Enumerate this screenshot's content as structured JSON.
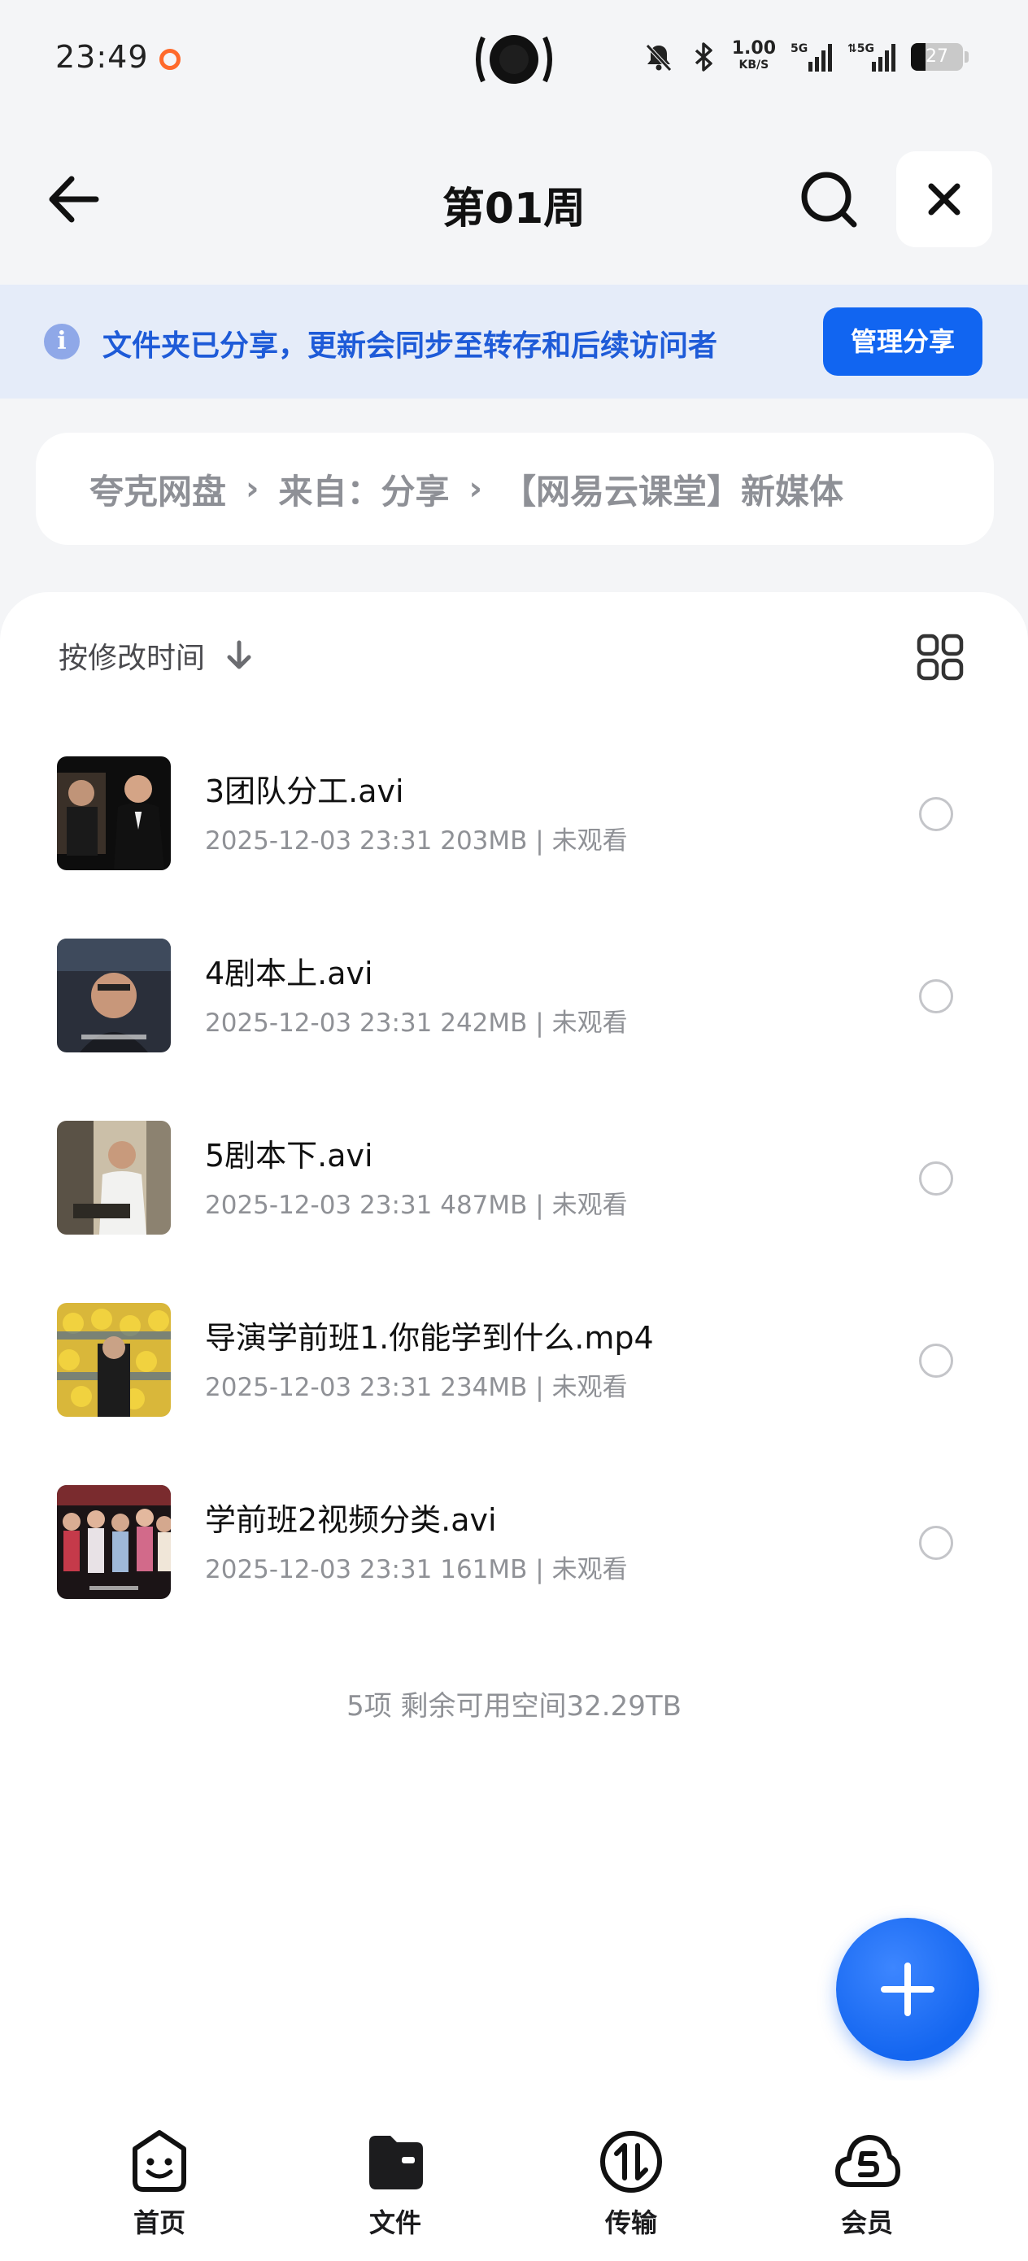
{
  "status_bar": {
    "time": "23:49",
    "net_speed": "1.00",
    "net_unit": "KB/S",
    "signal1": "5G",
    "signal2": "5G",
    "battery": "27"
  },
  "header": {
    "title": "第01周"
  },
  "share_banner": {
    "message": "文件夹已分享，更新会同步至转存和后续访问者",
    "button_label": "管理分享"
  },
  "breadcrumb": {
    "items": [
      "夸克网盘",
      "来自：分享",
      "【网易云课堂】新媒体"
    ]
  },
  "toolbar": {
    "sort_label": "按修改时间"
  },
  "files": [
    {
      "name": "3团队分工.avi",
      "date": "2025-12-03 23:31",
      "size": "203MB",
      "status": "未观看"
    },
    {
      "name": "4剧本上.avi",
      "date": "2025-12-03 23:31",
      "size": "242MB",
      "status": "未观看"
    },
    {
      "name": "5剧本下.avi",
      "date": "2025-12-03 23:31",
      "size": "487MB",
      "status": "未观看"
    },
    {
      "name": "导演学前班1.你能学到什么.mp4",
      "date": "2025-12-03 23:31",
      "size": "234MB",
      "status": "未观看"
    },
    {
      "name": "学前班2视频分类.avi",
      "date": "2025-12-03 23:31",
      "size": "161MB",
      "status": "未观看"
    }
  ],
  "summary": "5项 剩余可用空间32.29TB",
  "tabbar": {
    "items": [
      {
        "label": "首页",
        "icon": "face-icon"
      },
      {
        "label": "文件",
        "icon": "folder-icon"
      },
      {
        "label": "传输",
        "icon": "transfer-icon"
      },
      {
        "label": "会员",
        "icon": "cloud-icon"
      }
    ]
  },
  "colors": {
    "accent": "#1165f1",
    "banner_bg": "#e5ecf9",
    "banner_text": "#1e5bd8"
  }
}
